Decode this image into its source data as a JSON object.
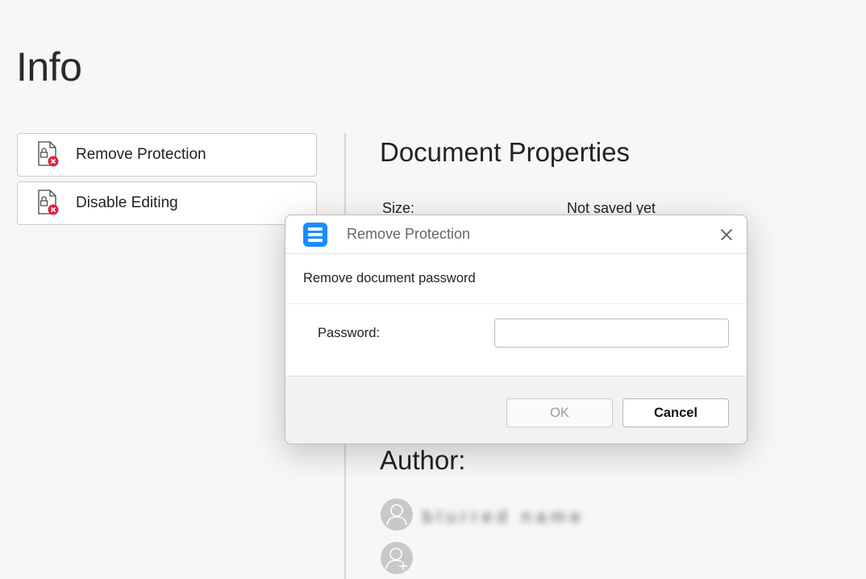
{
  "page": {
    "title": "Info"
  },
  "actions": [
    {
      "label": "Remove Protection",
      "icon": "protected-document-remove-icon"
    },
    {
      "label": "Disable Editing",
      "icon": "protected-document-remove-icon"
    }
  ],
  "properties": {
    "title": "Document Properties",
    "size_label": "Size:",
    "size_value": "Not saved yet"
  },
  "author": {
    "title": "Author:",
    "name": "blurred name"
  },
  "dialog": {
    "title": "Remove Protection",
    "heading": "Remove document password",
    "password_label": "Password:",
    "password_value": "",
    "ok_label": "OK",
    "cancel_label": "Cancel"
  },
  "colors": {
    "accent": "#1a8cff",
    "error_badge": "#e0243e",
    "background": "#f7f7f7"
  }
}
